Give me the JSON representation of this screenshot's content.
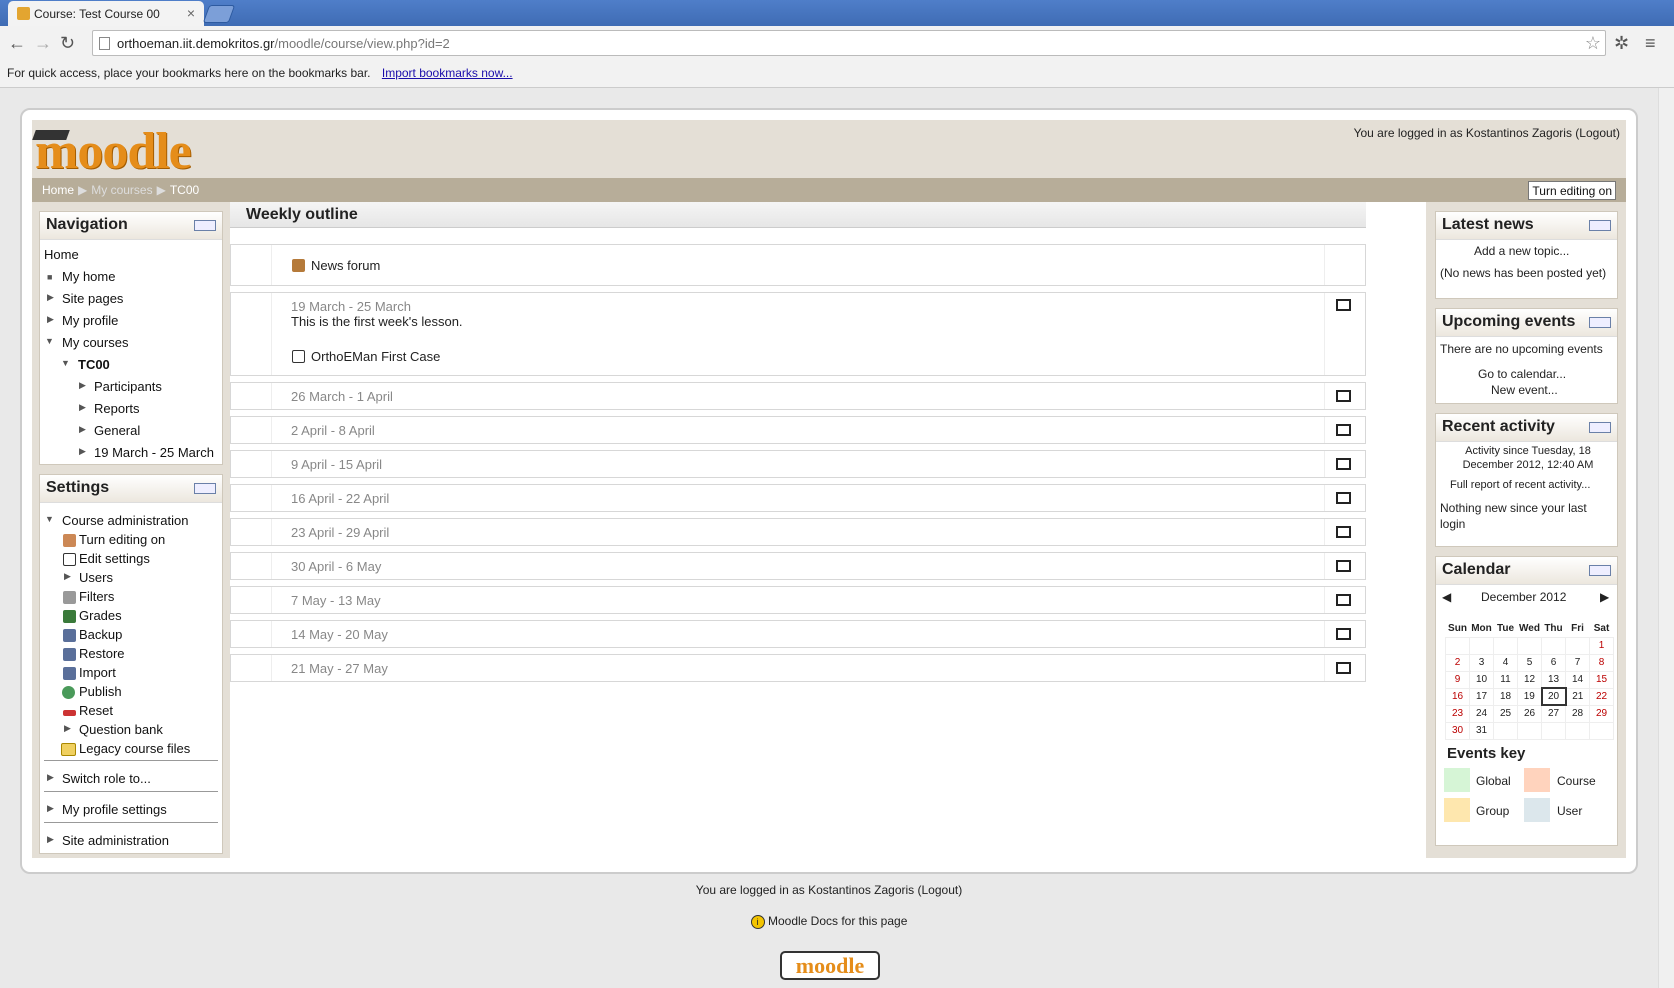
{
  "browser": {
    "tab_title": "Course: Test Course 00",
    "url_domain": "orthoeman.iit.demokritos.gr",
    "url_path": "/moodle/course/view.php?id=2",
    "bookmarks_prompt": "For quick access, place your bookmarks here on the bookmarks bar.",
    "bookmarks_link": "Import bookmarks now..."
  },
  "header": {
    "logo": "moodle",
    "login_info": "You are logged in as Kostantinos Zagoris (Logout)",
    "breadcrumb": [
      "Home",
      "My courses",
      "TC00"
    ],
    "edit_button": "Turn editing on"
  },
  "navigation": {
    "title": "Navigation",
    "items": [
      "Home",
      "My home",
      "Site pages",
      "My profile",
      "My courses",
      "TC00",
      "Participants",
      "Reports",
      "General",
      "19 March - 25 March"
    ]
  },
  "settings": {
    "title": "Settings",
    "course_admin": "Course administration",
    "items": [
      "Turn editing on",
      "Edit settings",
      "Users",
      "Filters",
      "Grades",
      "Backup",
      "Restore",
      "Import",
      "Publish",
      "Reset",
      "Question bank",
      "Legacy course files"
    ],
    "switch_role": "Switch role to...",
    "my_profile_settings": "My profile settings",
    "site_admin": "Site administration"
  },
  "main": {
    "title": "Weekly outline",
    "news_forum": "News forum",
    "first_week": {
      "dates": "19 March - 25 March",
      "summary": "This is the first week's lesson.",
      "activity": "OrthoEMan First Case"
    },
    "weeks": [
      "26 March - 1 April",
      "2 April - 8 April",
      "9 April - 15 April",
      "16 April - 22 April",
      "23 April - 29 April",
      "30 April - 6 May",
      "7 May - 13 May",
      "14 May - 20 May",
      "21 May - 27 May"
    ]
  },
  "latest_news": {
    "title": "Latest news",
    "add": "Add a new topic...",
    "none": "(No news has been posted yet)"
  },
  "upcoming": {
    "title": "Upcoming events",
    "none": "There are no upcoming events",
    "goto": "Go to calendar...",
    "new": "New event..."
  },
  "recent": {
    "title": "Recent activity",
    "since": "Activity since Tuesday, 18 December 2012, 12:40 AM",
    "full": "Full report of recent activity...",
    "nothing": "Nothing new since your last login"
  },
  "calendar": {
    "title": "Calendar",
    "month": "December 2012",
    "days": [
      "Sun",
      "Mon",
      "Tue",
      "Wed",
      "Thu",
      "Fri",
      "Sat"
    ],
    "weeks": [
      [
        "",
        "",
        "",
        "",
        "",
        "",
        "1"
      ],
      [
        "2",
        "3",
        "4",
        "5",
        "6",
        "7",
        "8"
      ],
      [
        "9",
        "10",
        "11",
        "12",
        "13",
        "14",
        "15"
      ],
      [
        "16",
        "17",
        "18",
        "19",
        "20",
        "21",
        "22"
      ],
      [
        "23",
        "24",
        "25",
        "26",
        "27",
        "28",
        "29"
      ],
      [
        "30",
        "31",
        "",
        "",
        "",
        "",
        ""
      ]
    ],
    "today": "20",
    "events_key_title": "Events key",
    "keys": [
      "Global",
      "Course",
      "Group",
      "User"
    ],
    "key_colors": [
      "#d6f5d6",
      "#ffd3bd",
      "#fee7ae",
      "#dce7ec"
    ]
  },
  "footer": {
    "login_info": "You are logged in as Kostantinos Zagoris (Logout)",
    "docs": "Moodle Docs for this page",
    "logo": "moodle"
  }
}
